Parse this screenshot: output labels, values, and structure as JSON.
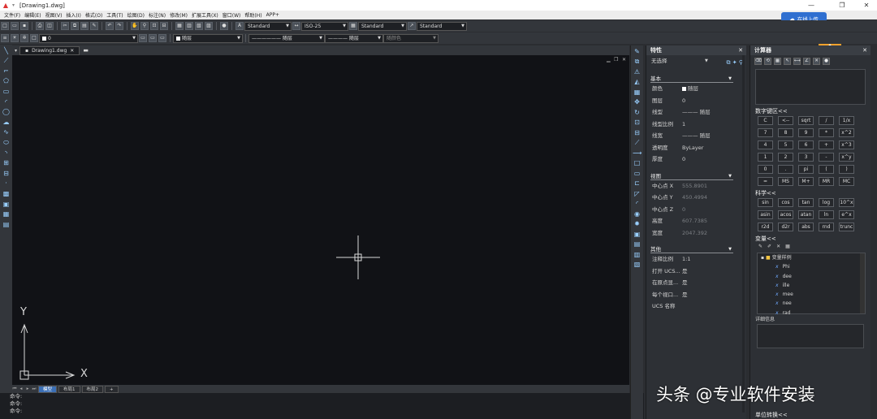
{
  "window": {
    "title": "[Drawing1.dwg]",
    "minimize": "—",
    "restore": "❐",
    "close": "✕"
  },
  "menu": [
    "文件(F)",
    "编辑(E)",
    "视图(V)",
    "插入(I)",
    "格式(O)",
    "工具(T)",
    "绘图(D)",
    "标注(N)",
    "修改(M)",
    "扩展工具(X)",
    "窗口(W)",
    "帮助(H)",
    "APP+"
  ],
  "cloud_button": "在线上传",
  "toolbar": {
    "text_style": "Standard",
    "dim_style": "ISO-25",
    "table_style": "Standard",
    "multileader_style": "Standard",
    "layer": "0",
    "color": "随层",
    "linetype": "随层",
    "lineweight": "随层",
    "plot_style": "随颜色"
  },
  "doc_tab": {
    "name": "Drawing1.dwg",
    "close": "✕"
  },
  "axes": {
    "x": "X",
    "y": "Y"
  },
  "layout_tabs": [
    "模型",
    "布局1",
    "布局2",
    "+"
  ],
  "command_lines": [
    "命令:",
    "命令:",
    "命令:"
  ],
  "properties": {
    "title": "特性",
    "selection": "无选择",
    "sections": {
      "basic": "基本",
      "view": "视图",
      "misc": "其他"
    },
    "basic_rows": [
      {
        "key": "颜色",
        "value": "随层"
      },
      {
        "key": "图层",
        "value": "0"
      },
      {
        "key": "线型",
        "value": "——— 随层"
      },
      {
        "key": "线型比例",
        "value": "1"
      },
      {
        "key": "线宽",
        "value": "——— 随层"
      },
      {
        "key": "透明度",
        "value": "ByLayer"
      },
      {
        "key": "厚度",
        "value": "0"
      }
    ],
    "view_rows": [
      {
        "key": "中心点 X",
        "value": "555.8901"
      },
      {
        "key": "中心点 Y",
        "value": "450.4994"
      },
      {
        "key": "中心点 Z",
        "value": "0"
      },
      {
        "key": "高度",
        "value": "607.7385"
      },
      {
        "key": "宽度",
        "value": "2047.392"
      }
    ],
    "misc_rows": [
      {
        "key": "注释比例",
        "value": "1:1"
      },
      {
        "key": "打开 UCS...",
        "value": "是"
      },
      {
        "key": "在原点显...",
        "value": "是"
      },
      {
        "key": "每个视口...",
        "value": "是"
      },
      {
        "key": "UCS 名称",
        "value": ""
      }
    ]
  },
  "calculator": {
    "title": "计算器",
    "numpad_title": "数字键区<<",
    "numpad": [
      "C",
      "<--",
      "sqrt",
      "/",
      "1/x",
      "7",
      "8",
      "9",
      "*",
      "x^2",
      "4",
      "5",
      "6",
      "+",
      "x^3",
      "1",
      "2",
      "3",
      "-",
      "x^y",
      "0",
      ".",
      "pi",
      "(",
      ")",
      "=",
      "MS",
      "M+",
      "MR",
      "MC"
    ],
    "sci_title": "科学<<",
    "sci": [
      "sin",
      "cos",
      "tan",
      "log",
      "10^x",
      "asin",
      "acos",
      "atan",
      "ln",
      "e^x",
      "r2d",
      "d2r",
      "abs",
      "rnd",
      "trunc"
    ],
    "var_title": "变量<<",
    "var_folder": "变量样例",
    "variables": [
      "Phi",
      "dee",
      "ille",
      "mee",
      "nee",
      "rad"
    ],
    "detail_label": "详细信息",
    "unit_conv": "单位转换<<"
  },
  "watermark": "头条 @专业软件安装"
}
